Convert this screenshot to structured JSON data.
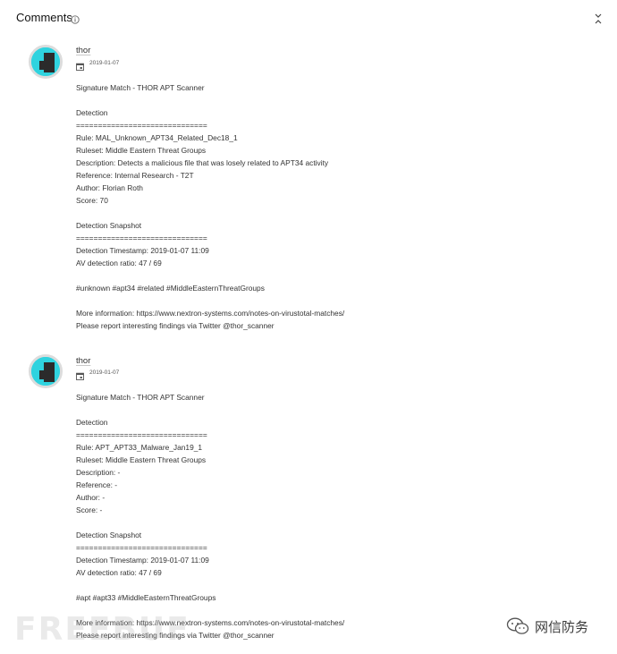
{
  "header": {
    "title": "Comments",
    "info_icon": "info-icon",
    "collapse_icon": "chevrons-collapse-icon"
  },
  "comments": [
    {
      "author": "thor",
      "date": "2019-01-07",
      "lines": [
        "Signature Match - THOR APT Scanner",
        "",
        "Detection",
        "==============================",
        "Rule: MAL_Unknown_APT34_Related_Dec18_1",
        "Ruleset: Middle Eastern Threat Groups",
        "Description: Detects a malicious file that was losely related to APT34 activity",
        "Reference: Internal Research - T2T",
        "Author: Florian Roth",
        "Score: 70",
        "",
        "Detection Snapshot",
        "==============================",
        "Detection Timestamp: 2019-01-07 11:09",
        "AV detection ratio: 47 / 69",
        "",
        "#unknown #apt34 #related #MiddleEasternThreatGroups",
        "",
        "More information: https://www.nextron-systems.com/notes-on-virustotal-matches/",
        "Please report interesting findings via Twitter @thor_scanner"
      ]
    },
    {
      "author": "thor",
      "date": "2019-01-07",
      "lines": [
        "Signature Match - THOR APT Scanner",
        "",
        "Detection",
        "==============================",
        "Rule: APT_APT33_Malware_Jan19_1",
        "Ruleset: Middle Eastern Threat Groups",
        "Description: -",
        "Reference: -",
        "Author: -",
        "Score: -",
        "",
        "Detection Snapshot",
        "==============================",
        "Detection Timestamp: 2019-01-07 11:09",
        "AV detection ratio: 47 / 69",
        "",
        "#apt #apt33 #MiddleEasternThreatGroups",
        "",
        "More information: https://www.nextron-systems.com/notes-on-virustotal-matches/",
        "Please report interesting findings via Twitter @thor_scanner"
      ]
    }
  ],
  "watermarks": {
    "left_text": "FREEBUF",
    "right_text": "网信防务",
    "right_icon": "wechat-icon"
  },
  "colors": {
    "avatar_bg": "#2fd3df",
    "avatar_mark": "#2b2b2b",
    "text": "#333333"
  }
}
